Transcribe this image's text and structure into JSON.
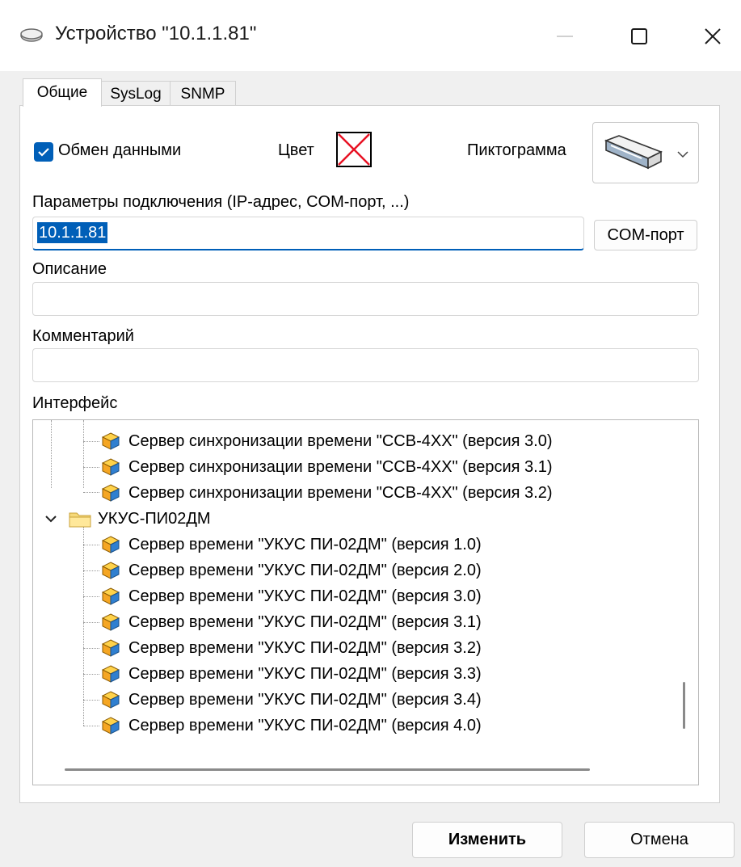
{
  "window": {
    "title": "Устройство \"10.1.1.81\"",
    "icon": "device-icon"
  },
  "tabs": [
    {
      "label": "Общие",
      "active": true
    },
    {
      "label": "SysLog",
      "active": false
    },
    {
      "label": "SNMP",
      "active": false
    }
  ],
  "general": {
    "exchange_label": "Обмен данными",
    "exchange_checked": true,
    "color_label": "Цвет",
    "icon_label": "Пиктограмма",
    "connection_label": "Параметры подключения (IP-адрес, COM-порт, ...)",
    "connection_value": "10.1.1.81",
    "com_port_button": "COM-порт",
    "description_label": "Описание",
    "description_value": "",
    "comment_label": "Комментарий",
    "comment_value": "",
    "interface_label": "Интерфейс"
  },
  "tree": {
    "ssv_items": [
      "Сервер синхронизации времени \"ССВ-4ХХ\" (версия 3.0)",
      "Сервер синхронизации времени \"ССВ-4ХХ\" (версия 3.1)",
      "Сервер синхронизации времени \"ССВ-4ХХ\" (версия 3.2)"
    ],
    "folder": "УКУС-ПИ02ДМ",
    "ukus_items": [
      "Сервер времени \"УКУС ПИ-02ДМ\" (версия 1.0)",
      "Сервер времени \"УКУС ПИ-02ДМ\" (версия 2.0)",
      "Сервер времени \"УКУС ПИ-02ДМ\" (версия 3.0)",
      "Сервер времени \"УКУС ПИ-02ДМ\" (версия 3.1)",
      "Сервер времени \"УКУС ПИ-02ДМ\" (версия 3.2)",
      "Сервер времени \"УКУС ПИ-02ДМ\" (версия 3.3)",
      "Сервер времени \"УКУС ПИ-02ДМ\" (версия 3.4)",
      "Сервер времени \"УКУС ПИ-02ДМ\" (версия 4.0)"
    ]
  },
  "buttons": {
    "ok": "Изменить",
    "cancel": "Отмена"
  },
  "colors": {
    "accent": "#005fb8",
    "color_swatch_cross": "#e81123"
  }
}
